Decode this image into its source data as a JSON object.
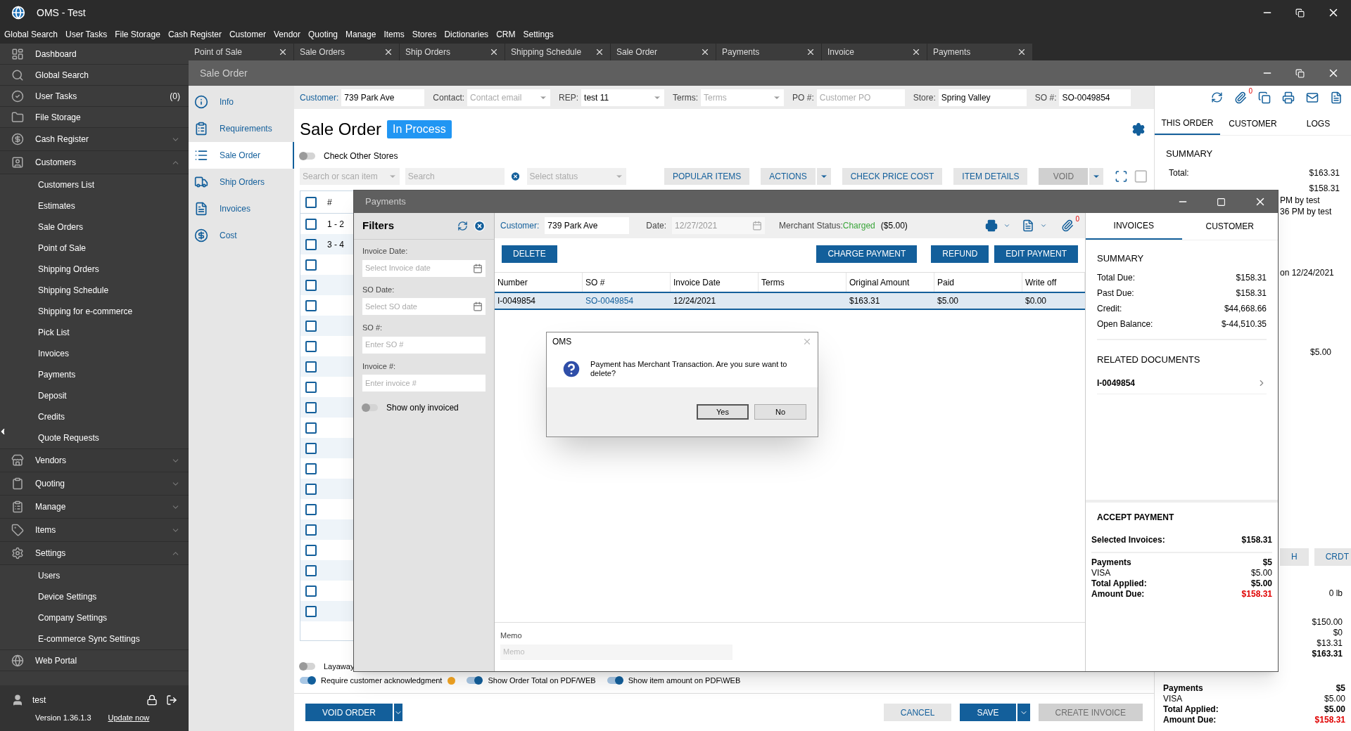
{
  "window": {
    "title": "OMS - Test"
  },
  "menu": [
    "Global Search",
    "User Tasks",
    "File Storage",
    "Cash Register",
    "Customer",
    "Vendor",
    "Quoting",
    "Manage",
    "Items",
    "Stores",
    "Dictionaries",
    "CRM",
    "Settings"
  ],
  "sidebar": {
    "items": [
      {
        "label": "Dashboard"
      },
      {
        "label": "Global Search"
      },
      {
        "label": "User Tasks",
        "badge": "(0)"
      },
      {
        "label": "File Storage"
      },
      {
        "label": "Cash Register",
        "expanded": false
      },
      {
        "label": "Customers",
        "expanded": true,
        "children": [
          {
            "label": "Customers List"
          },
          {
            "label": "Estimates"
          },
          {
            "label": "Sale Orders"
          },
          {
            "label": "Point of Sale"
          },
          {
            "label": "Shipping Orders"
          },
          {
            "label": "Shipping Schedule"
          },
          {
            "label": "Shipping for e-commerce"
          },
          {
            "label": "Pick List"
          },
          {
            "label": "Invoices"
          },
          {
            "label": "Payments"
          },
          {
            "label": "Deposit"
          },
          {
            "label": "Credits"
          },
          {
            "label": "Quote Requests"
          }
        ]
      },
      {
        "label": "Vendors",
        "expanded": false
      },
      {
        "label": "Quoting",
        "expanded": false
      },
      {
        "label": "Manage",
        "expanded": false
      },
      {
        "label": "Items",
        "expanded": false
      },
      {
        "label": "Settings",
        "expanded": true,
        "children": [
          {
            "label": "Users"
          },
          {
            "label": "Device Settings"
          },
          {
            "label": "Company Settings"
          },
          {
            "label": "E-commerce Sync Settings"
          }
        ]
      },
      {
        "label": "Web Portal"
      }
    ],
    "user": "test",
    "version": "Version 1.36.1.3",
    "update_link": "Update now"
  },
  "tabs": [
    "Point of Sale",
    "Sale Orders",
    "Ship Orders",
    "Shipping Schedule",
    "Sale Order",
    "Payments",
    "Invoice",
    "Payments"
  ],
  "sale_order": {
    "title": "Sale Order",
    "nav": [
      {
        "label": "Info",
        "selected": false
      },
      {
        "label": "Requirements",
        "selected": false
      },
      {
        "label": "Sale Order",
        "selected": true
      },
      {
        "label": "Ship Orders",
        "selected": false
      },
      {
        "label": "Invoices",
        "selected": false
      },
      {
        "label": "Cost",
        "selected": false
      }
    ],
    "fields": [
      {
        "label": "Customer:",
        "label_link": true,
        "kind": "text",
        "value": "739 Park Ave"
      },
      {
        "label": "Contact:",
        "label_link": false,
        "kind": "select",
        "placeholder": "Contact email"
      },
      {
        "label": "REP:",
        "label_link": false,
        "kind": "select",
        "value": "test 11"
      },
      {
        "label": "Terms:",
        "label_link": false,
        "kind": "select",
        "placeholder": "Terms"
      },
      {
        "label": "PO #:",
        "label_link": false,
        "kind": "text",
        "placeholder": "Customer PO"
      },
      {
        "label": "Store:",
        "label_link": false,
        "kind": "text",
        "value": "Spring Valley"
      },
      {
        "label": "SO #:",
        "label_link": false,
        "kind": "text",
        "value": "SO-0049854"
      }
    ],
    "heading": "Sale Order",
    "status": "In Process",
    "check_other_stores": {
      "label": "Check Other Stores",
      "on": false
    },
    "search": {
      "item_placeholder": "Search or scan item",
      "search_placeholder": "Search",
      "status_placeholder": "Select status"
    },
    "toolbar": [
      {
        "label": "POPULAR ITEMS",
        "split": false,
        "disabled": false
      },
      {
        "label": "ACTIONS",
        "split": true,
        "disabled": false
      },
      {
        "label": "CHECK PRICE COST",
        "split": false,
        "disabled": false
      },
      {
        "label": "ITEM DETAILS",
        "split": false,
        "disabled": false
      },
      {
        "label": "VOID",
        "split": true,
        "disabled": true
      }
    ],
    "table": {
      "header": "#",
      "header_checked": false,
      "rows": [
        {
          "label": "1 - 2",
          "checked": false
        },
        {
          "label": "3 - 4",
          "checked": false
        },
        {
          "checked": false
        },
        {
          "checked": false
        },
        {
          "checked": false
        },
        {
          "checked": false
        },
        {
          "checked": false
        },
        {
          "checked": false
        },
        {
          "checked": false
        },
        {
          "checked": false
        },
        {
          "checked": false
        },
        {
          "checked": false
        },
        {
          "checked": false
        },
        {
          "checked": false
        },
        {
          "checked": false
        },
        {
          "checked": false
        },
        {
          "checked": false
        },
        {
          "checked": false
        },
        {
          "checked": false
        },
        {
          "checked": false
        }
      ]
    },
    "layaway": {
      "label": "Layaway",
      "on": false
    },
    "options": [
      {
        "label": "Require customer acknowledgment",
        "on": true,
        "warning": true
      },
      {
        "label": "Show Order Total on PDF/WEB",
        "on": true,
        "warning": false
      },
      {
        "label": "Show item amount on PDF\\WEB",
        "on": true,
        "warning": false
      }
    ],
    "footer_left": [
      {
        "label": "VOID ORDER",
        "kind": "primary",
        "split": true,
        "disabled": false
      }
    ],
    "footer_right": [
      {
        "label": "CANCEL",
        "kind": "secondary",
        "split": false,
        "disabled": false
      },
      {
        "label": "SAVE",
        "kind": "primary",
        "split": true,
        "disabled": false
      },
      {
        "label": "CREATE INVOICE",
        "kind": "primary",
        "split": false,
        "disabled": true
      }
    ],
    "side": {
      "attachments": "0",
      "tabs": [
        {
          "label": "THIS ORDER",
          "selected": true
        },
        {
          "label": "CUSTOMER",
          "selected": false
        },
        {
          "label": "LOGS",
          "selected": false
        }
      ],
      "summary_title": "SUMMARY",
      "total_label": "Total:",
      "total": "$163.31",
      "second": "$158.31",
      "log_lines": [
        "PM by test",
        "36 PM by test"
      ],
      "date_note": "on 12/24/2021",
      "paid": "$5.00",
      "pay_buttons": [
        "H",
        "CRDT"
      ],
      "weight": "0 lb",
      "amounts": [
        "$150.00",
        "$0",
        "$13.31"
      ],
      "amount_total": "$163.31",
      "payments": [
        {
          "label": "Payments",
          "value": "$5",
          "kind": "bold"
        },
        {
          "label": "VISA",
          "value": "$5.00",
          "kind": "plain"
        },
        {
          "label": "Total Applied:",
          "value": "$5.00",
          "kind": "bold"
        },
        {
          "label": "Amount Due:",
          "value": "$158.31",
          "kind": "due"
        }
      ]
    }
  },
  "payments_window": {
    "title": "Payments",
    "filters": {
      "title": "Filters",
      "fields": [
        {
          "label": "Invoice Date:",
          "placeholder": "Select Invoice date",
          "kind": "date"
        },
        {
          "label": "SO Date:",
          "placeholder": "Select SO date",
          "kind": "date"
        },
        {
          "label": "SO #:",
          "placeholder": "Enter SO #",
          "kind": "text"
        },
        {
          "label": "Invoice #:",
          "placeholder": "Enter invoice #",
          "kind": "text"
        }
      ],
      "toggle": {
        "label": "Show only invoiced",
        "on": false
      }
    },
    "customer_label": "Customer:",
    "customer": "739 Park Ave",
    "date_label": "Date:",
    "date": "12/27/2021",
    "merchant_label": "Merchant Status:",
    "merchant_status": "Charged",
    "merchant_amount": "($5.00)",
    "attachments": "0",
    "buttons_left": [
      "DELETE"
    ],
    "buttons_right": [
      "CHARGE PAYMENT",
      "REFUND",
      "EDIT PAYMENT"
    ],
    "columns": [
      "Number",
      "SO #",
      "Invoice Date",
      "Terms",
      "Original Amount",
      "Paid",
      "Write off"
    ],
    "rows": [
      {
        "selected": true,
        "cells": [
          "I-0049854",
          "SO-0049854",
          "12/24/2021",
          null,
          "$163.31",
          "$5.00",
          "$0.00"
        ]
      }
    ],
    "memo_label": "Memo",
    "memo_placeholder": "Memo",
    "tabs": [
      {
        "label": "INVOICES",
        "selected": true
      },
      {
        "label": "CUSTOMER",
        "selected": false
      }
    ],
    "summary_title": "SUMMARY",
    "summary": [
      {
        "label": "Total Due:",
        "value": "$158.31"
      },
      {
        "label": "Past Due:",
        "value": "$158.31"
      },
      {
        "label": "Credit:",
        "value": "$44,668.66"
      },
      {
        "label": "Open Balance:",
        "value": "$-44,510.35"
      }
    ],
    "related_title": "RELATED DOCUMENTS",
    "related": [
      "I-0049854"
    ],
    "accept_title": "ACCEPT PAYMENT",
    "selected_label": "Selected Invoices:",
    "selected_value": "$158.31",
    "payments": [
      {
        "label": "Payments",
        "value": "$5",
        "kind": "bold"
      },
      {
        "label": "VISA",
        "value": "$5.00",
        "kind": "plain"
      },
      {
        "label": "Total Applied:",
        "value": "$5.00",
        "kind": "bold"
      },
      {
        "label": "Amount Due:",
        "value": "$158.31",
        "kind": "due"
      }
    ]
  },
  "dialog": {
    "title": "OMS",
    "message": "Payment has Merchant Transaction. Are you sure want to delete?",
    "buttons": [
      {
        "label": "Yes",
        "default": true
      },
      {
        "label": "No",
        "default": false
      }
    ]
  }
}
